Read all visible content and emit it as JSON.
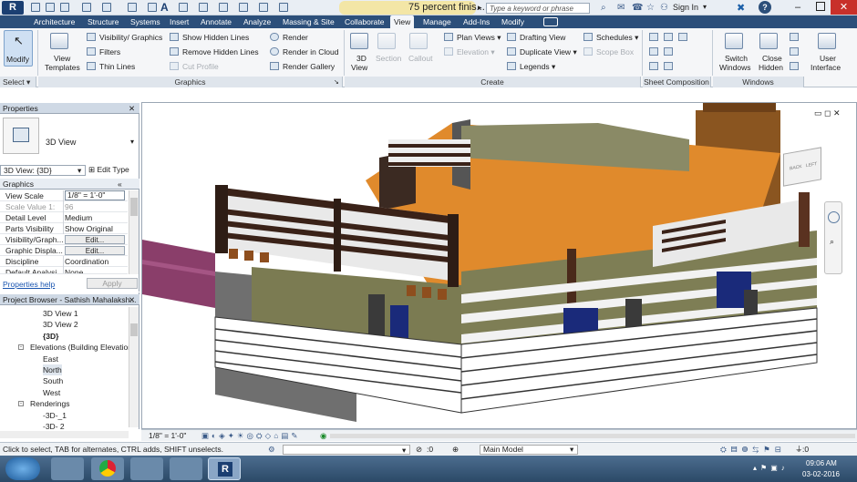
{
  "app": {
    "logo_letter": "R",
    "doc_title": "75 percent finis...",
    "search_placeholder": "Type a keyword or phrase",
    "sign_in": "Sign In"
  },
  "tabs": [
    "Architecture",
    "Structure",
    "Systems",
    "Insert",
    "Annotate",
    "Analyze",
    "Massing & Site",
    "Collaborate",
    "View",
    "Manage",
    "Add-Ins",
    "Modify"
  ],
  "active_tab": "View",
  "ribbon": {
    "modify": "Modify",
    "select": "Select",
    "view_templates": [
      "View",
      "Templates"
    ],
    "visibility_graphics": "Visibility/ Graphics",
    "filters": "Filters",
    "thin_lines": "Thin Lines",
    "show_hidden_lines": "Show  Hidden Lines",
    "remove_hidden_lines": "Remove  Hidden Lines",
    "cut_profile": "Cut  Profile",
    "render": "Render",
    "render_in_cloud": "Render  in Cloud",
    "render_gallery": "Render  Gallery",
    "graphics_panel": "Graphics",
    "three_d_view": [
      "3D",
      "View"
    ],
    "section": "Section",
    "callout": "Callout",
    "plan_views": "Plan  Views",
    "elevation": "Elevation",
    "drafting_view": "Drafting  View",
    "duplicate_view": "Duplicate  View",
    "legends": "Legends",
    "schedules": "Schedules",
    "scope_box": "Scope  Box",
    "create_panel": "Create",
    "sheet_composition_panel": "Sheet Composition",
    "switch_windows": [
      "Switch",
      "Windows"
    ],
    "close_hidden": [
      "Close",
      "Hidden"
    ],
    "user_interface": [
      "User",
      "Interface"
    ],
    "windows_panel": "Windows"
  },
  "properties": {
    "title": "Properties",
    "type_name": "3D View",
    "selector": "3D View: {3D}",
    "edit_type": "Edit Type",
    "group": "Graphics",
    "rows": [
      {
        "k": "View Scale",
        "v": "1/8\" = 1'-0\""
      },
      {
        "k": "Scale Value    1:",
        "v": "96"
      },
      {
        "k": "Detail Level",
        "v": "Medium"
      },
      {
        "k": "Parts Visibility",
        "v": "Show Original"
      },
      {
        "k": "Visibility/Graph...",
        "v": "Edit..."
      },
      {
        "k": "Graphic Displa...",
        "v": "Edit..."
      },
      {
        "k": "Discipline",
        "v": "Coordination"
      },
      {
        "k": "Default Analysi...",
        "v": "None"
      }
    ],
    "help": "Properties help",
    "apply": "Apply"
  },
  "browser": {
    "title": "Project Browser - Sathish Mahalaksh...",
    "items": [
      {
        "label": "3D View 1",
        "indent": 47,
        "bold": false
      },
      {
        "label": "3D View 2",
        "indent": 47,
        "bold": false
      },
      {
        "label": "{3D}",
        "indent": 47,
        "bold": true
      },
      {
        "label": "Elevations (Building Elevation",
        "indent": 33,
        "bold": false,
        "expander": "-"
      },
      {
        "label": "East",
        "indent": 47,
        "bold": false
      },
      {
        "label": "North",
        "indent": 47,
        "bold": false,
        "selected": true
      },
      {
        "label": "South",
        "indent": 47,
        "bold": false
      },
      {
        "label": "West",
        "indent": 47,
        "bold": false
      },
      {
        "label": "Renderings",
        "indent": 33,
        "bold": false,
        "expander": "-"
      },
      {
        "label": "-3D-_1",
        "indent": 47,
        "bold": false
      },
      {
        "label": "-3D- 2",
        "indent": 47,
        "bold": false
      }
    ]
  },
  "viewbar": {
    "scale": "1/8\" = 1'-0\""
  },
  "viewcube": {
    "left": "BACK",
    "right": "LEFT"
  },
  "status": {
    "message": "Click to select, TAB for alternates, CTRL adds, SHIFT unselects.",
    "counter": ":0",
    "model": "Main Model",
    "filter_count": ":0"
  },
  "clock": {
    "time": "09:06 AM",
    "date": "03-02-2016"
  },
  "colors": {
    "accent": "#2c4f7a",
    "floor": "#e08a2c",
    "wall_green": "#7b7b52",
    "dark_wood": "#3a2218",
    "brick": "#8e4e1e"
  }
}
